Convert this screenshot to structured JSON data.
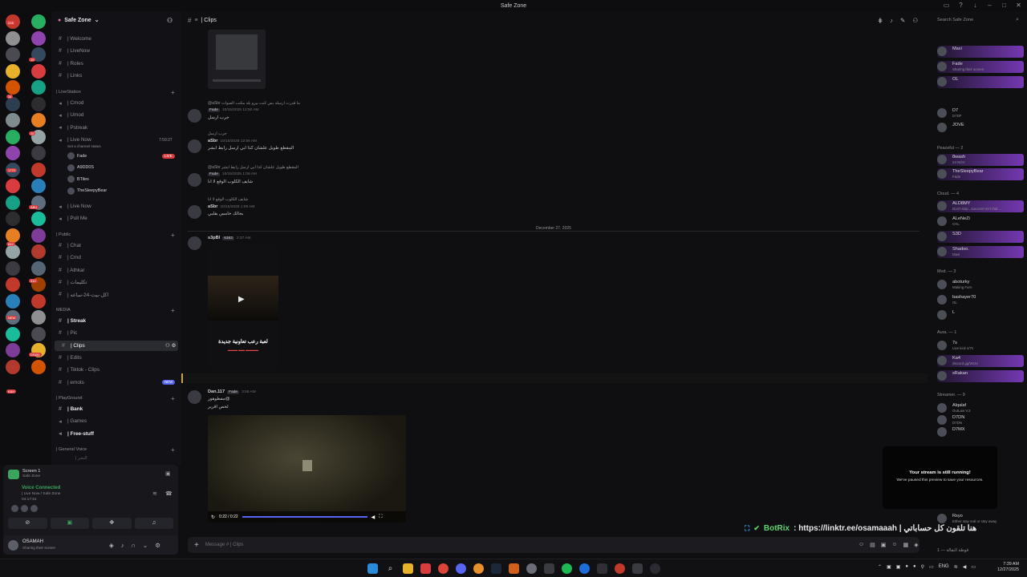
{
  "window": {
    "title": "Safe Zone"
  },
  "server": {
    "name": "Safe Zone"
  },
  "rail_badges": [
    "228",
    "10",
    "34",
    "20",
    "1770",
    "ABU",
    "642",
    "312",
    "NEW",
    "DS@1",
    "K&H"
  ],
  "channels": {
    "top": [
      {
        "name": "| Welcome"
      },
      {
        "name": "| LiveNow"
      },
      {
        "name": "| Roles"
      },
      {
        "name": "| Links"
      }
    ],
    "livestation_label": "| LiveStation",
    "livestation": [
      {
        "name": "| Cmod"
      },
      {
        "name": "| Umod"
      },
      {
        "name": "| Pstreak"
      }
    ],
    "live_now": {
      "name": "| Live Now",
      "timer": "7:59:27",
      "status": "Set a channel status",
      "live": "LIVE"
    },
    "voice_users": [
      {
        "name": "Fade"
      },
      {
        "name": "A9DD0S"
      },
      {
        "name": "BTiles"
      },
      {
        "name": "TheSleepyBear"
      }
    ],
    "voice2": [
      {
        "name": "| Live Now"
      },
      {
        "name": "| Pull Me"
      }
    ],
    "public_label": "| Public",
    "public": [
      {
        "name": "| Chat"
      },
      {
        "name": "| Cmd"
      },
      {
        "name": "| Athkar"
      },
      {
        "name": "| تكليمات"
      },
      {
        "name": "| اكل-بيت-24-ساعه"
      }
    ],
    "media_label": "MEDIA",
    "media": [
      {
        "name": "| Streak",
        "bold": true
      },
      {
        "name": "| Pic"
      },
      {
        "name": "| Clips",
        "active": true
      },
      {
        "name": "| Edits"
      },
      {
        "name": "| Tiktok - Clips"
      },
      {
        "name": "| emots",
        "badge": "NEW"
      }
    ],
    "playground_label": "| PlayGround",
    "playground": [
      {
        "name": "| Bank",
        "bold": true
      },
      {
        "name": "| Games"
      },
      {
        "name": "| Free-stuff",
        "bold": true
      }
    ],
    "general_voice_label": "| General Voice",
    "general_voice_first": "| البحر"
  },
  "voice_panel": {
    "stream_title": "Screen 1",
    "stream_sub": "Safe Zone",
    "connected": "Voice Connected",
    "location": "| Live Now / Safe Zone",
    "timer": "04:17:51"
  },
  "user": {
    "name": "OSAMAH",
    "status": "Sharing their screen"
  },
  "chat": {
    "channel": "| Clips",
    "date_divider": "December 27, 2025",
    "messages": [
      {
        "reply": "@aSbr ما قدرت ارسله بس كنت بيرو بله مكتب الصوات",
        "user": "",
        "tag": "Fade",
        "time": "10/15/2025 12:50 AM",
        "body": "جرب ارسل"
      },
      {
        "reply": "جرب ارسل",
        "user": "aSbr",
        "tag": "",
        "time": "10/15/2025 12:56 AM",
        "body": "المقطع طويل علشان كذا ابي ارسل رابط ابشر"
      },
      {
        "reply": "@aSbr المقطع طويل علشان كذا ابي ارسل رابط ابشر",
        "user": "",
        "tag": "Fade",
        "time": "10/15/2025 1:08 AM",
        "body": "شايف الكلوب الوقع لا انا"
      },
      {
        "reply": "شايف الكلوب الوقع لا انا",
        "user": "aSbr",
        "tag": "",
        "time": "10/15/2025 1:09 AM",
        "body": "بحالك خامس بقلبي"
      },
      {
        "reply": "",
        "user": "s3pBl",
        "tag": "6363",
        "time": "2:37 AM",
        "body": "",
        "video_title": "لعبة رعب تعاونية جديدة"
      },
      {
        "reply": "",
        "user": "Dan.117",
        "tag": "Fade",
        "time": "3:59 AM",
        "body": "مفطوهور@",
        "body2": "لخص اقرير"
      }
    ],
    "video_time": "0:22 / 0:22",
    "composer_placeholder": "Message # | Clips"
  },
  "members": {
    "search_placeholder": "Search Safe Zone",
    "top": [
      {
        "name": "Maxi",
        "status": ""
      },
      {
        "name": "Fade",
        "status": "Sharing their screen"
      },
      {
        "name": "OL",
        "status": ""
      },
      {
        "name": "D7",
        "status": "D7DF"
      },
      {
        "name": "JOVE",
        "status": ""
      }
    ],
    "peaceful_label": "Peaceful — 2",
    "peaceful": [
      {
        "name": "8wash",
        "status": "24 NOV"
      },
      {
        "name": "TheSleepyBear",
        "status": "Fade"
      }
    ],
    "cloud_label": "Cloud. — 4",
    "cloud": [
      {
        "name": "ALD8MY",
        "status": "Don't stop , success isn't that ..."
      },
      {
        "name": "ALeNeZi",
        "status": "CHL"
      },
      {
        "name": "S3D",
        "status": ""
      },
      {
        "name": "Shadoo.",
        "status": "Maxi"
      }
    ],
    "mod_label": "Mod. — 3",
    "mod": [
      {
        "name": "aboturky",
        "status": "Making Furn"
      },
      {
        "name": "bashayer70",
        "status": "OL"
      },
      {
        "name": "L",
        "status": ""
      }
    ],
    "aura_label": "Aura. — 1",
    "aura": [
      {
        "name": "7s",
        "status": "Live kick s/7s"
      },
      {
        "name": "Ka4",
        "status": "discord.gg/WUU"
      },
      {
        "name": "sRakan",
        "status": ""
      }
    ],
    "streamer_label": "Streamer. — 9",
    "streamer": [
      {
        "name": "Alqalaf",
        "status": "OutLaw V.2"
      },
      {
        "name": "D7DN",
        "status": "D7DN"
      },
      {
        "name": "D7MX",
        "status": ""
      }
    ],
    "bottom": [
      {
        "name": "Rsyo",
        "status": "Either stay real or stay away"
      }
    ],
    "bottom_label": "قوطة البقالة — 1"
  },
  "stream_overlay": {
    "line1": "Your stream is still running!",
    "line2": "We've paused this preview to save your resources."
  },
  "botrix": {
    "brand": "BotRix",
    "text": ": https://linktr.ee/osamaaah | هنا تلقون كل حساباتي"
  },
  "taskbar": {
    "lang": "ENG",
    "time": "7:39 AM",
    "date": "12/27/2025"
  }
}
